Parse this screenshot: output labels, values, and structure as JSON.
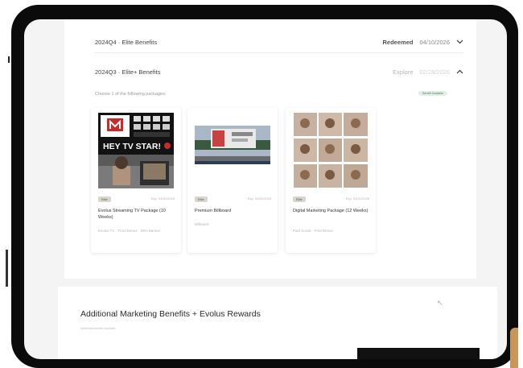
{
  "rows": [
    {
      "label": "2024Q4 · Elite Benefits",
      "status_label": "Redeemed",
      "status_date": "04/10/2026",
      "chevron": "chevron-down-icon"
    },
    {
      "label": "2024Q3 · Elite+ Benefits",
      "status_label": "Explore",
      "status_date": "02/28/2026",
      "chevron": "chevron-up-icon"
    }
  ],
  "choose_text": "Choose 1 of the following packages:",
  "select_badge": "Benefit Available",
  "packages": [
    {
      "tag": "Elite",
      "expiry": "Exp. 03/31/2026",
      "title": "Evolus Streaming TV Package (10 Weeks)",
      "subtitle": "Evolus TV · Third Bonus · 25% Banner"
    },
    {
      "tag": "Elite",
      "expiry": "Exp. 03/31/2026",
      "title": "Premium Billboard",
      "subtitle": "Billboard"
    },
    {
      "tag": "Elite",
      "expiry": "Exp. 03/31/2026",
      "title": "Digital Marketing Package (12 Weeks)",
      "subtitle": "Paid Social · Print Bonus"
    }
  ],
  "tv_graphic_text": "HEY TV STAR!",
  "bottom": {
    "title": "Additional Marketing Benefits + Evolus Rewards",
    "subtitle": "Additional benefits available"
  },
  "colors": {
    "bezel": "#0b0b0b",
    "screen_bg": "#f4f4f4",
    "tag_bg": "#d9d6ce",
    "badge_bg": "#e3efe6",
    "tv_red": "#c92a2a"
  }
}
